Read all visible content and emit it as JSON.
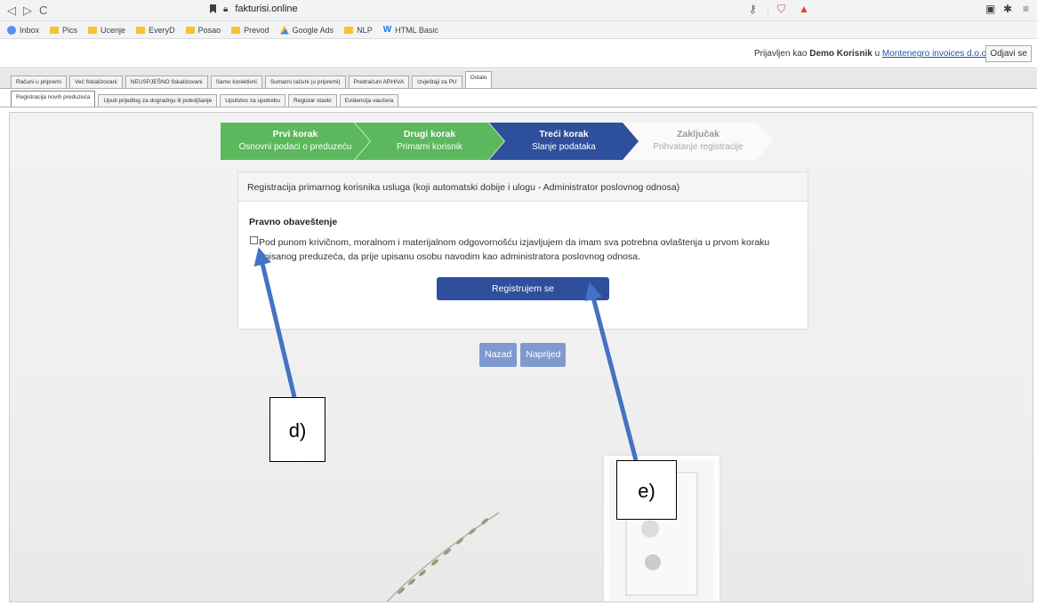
{
  "browser": {
    "url": "fakturisi.online",
    "bookmarks": [
      "Inbox",
      "Pics",
      "Ucenje",
      "EveryD",
      "Posao",
      "Prevod",
      "Google Ads",
      "NLP",
      "HTML Basic"
    ]
  },
  "header": {
    "prefix": "Prijavljen kao",
    "user": "Demo Korisnik",
    "in": "u",
    "company": "Montenegro invoices d.o.o.",
    "logout": "Odjavi se"
  },
  "main_tabs": [
    "Računi u pripremi",
    "Već fiskalizovani",
    "NEUSPJEŠNO fiskalizovani",
    "Samo korektivni",
    "Sumarni računi (u pripremi)",
    "Predračuni ARHIVA",
    "Izvještaji za PU",
    "Ostalo"
  ],
  "sub_tabs": [
    "Registracija novih preduzeća",
    "Uputi prijedlog za dogradnju ili poboljšanje",
    "Uputstvo za upotrebu",
    "Registar stavki",
    "Evidencija vaučera"
  ],
  "steps": [
    {
      "title": "Prvi korak",
      "subtitle": "Osnovni podaci o preduzeću"
    },
    {
      "title": "Drugi korak",
      "subtitle": "Primarni korisnik"
    },
    {
      "title": "Treći korak",
      "subtitle": "Slanje podataka"
    },
    {
      "title": "Zaključak",
      "subtitle": "Prihvatanje registracije"
    }
  ],
  "panel": {
    "heading": "Registracija primarnog korisnika usluga (koji automatski dobije i ulogu - Administrator poslovnog odnosa)",
    "legal_title": "Pravno obaveštenje",
    "legal_text": "Pod punom krivičnom, moralnom i materijalnom odgovornošću izjavljujem da imam sva potrebna ovlaštenja u prvom koraku upisanog preduzeća, da prije upisanu osobu navodim kao administratora poslovnog odnosa.",
    "register_button": "Registrujem se"
  },
  "nav": {
    "back": "Nazad",
    "forward": "Naprijed"
  },
  "annotations": {
    "d": "d)",
    "e": "e)"
  },
  "colors": {
    "green": "#5cb85c",
    "blue": "#2e4f9c",
    "arrow": "#4472c4"
  }
}
